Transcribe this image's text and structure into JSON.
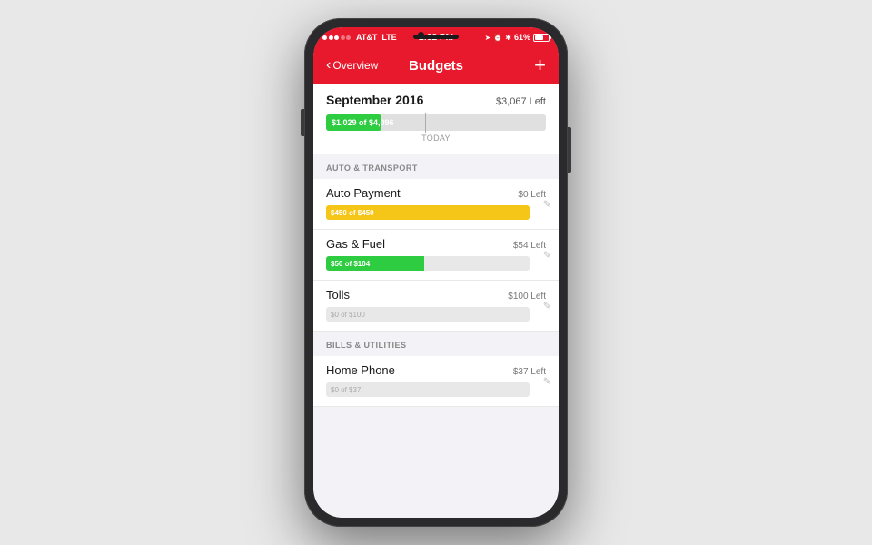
{
  "phone": {
    "status_bar": {
      "signal": "●●●○○",
      "carrier": "AT&T",
      "network": "LTE",
      "time": "2:32 PM",
      "battery_percent": "61%"
    },
    "nav": {
      "back_label": "Overview",
      "title": "Budgets",
      "add_label": "+"
    },
    "september": {
      "title": "September 2016",
      "amount_left": "$3,067 Left",
      "progress_label": "$1,029 of $4,096",
      "progress_percent": 25,
      "today_label": "TODAY"
    },
    "categories": [
      {
        "name": "AUTO & TRANSPORT",
        "items": [
          {
            "name": "Auto Payment",
            "left": "$0 Left",
            "progress_label": "$450 of $450",
            "progress_percent": 100,
            "color": "yellow"
          },
          {
            "name": "Gas & Fuel",
            "left": "$54 Left",
            "progress_label": "$50 of $104",
            "progress_percent": 48,
            "color": "green"
          },
          {
            "name": "Tolls",
            "left": "$100 Left",
            "progress_label": "$0 of $100",
            "progress_percent": 0,
            "color": "green"
          }
        ]
      },
      {
        "name": "BILLS & UTILITIES",
        "items": [
          {
            "name": "Home Phone",
            "left": "$37 Left",
            "progress_label": "$0 of $37",
            "progress_percent": 0,
            "color": "green"
          }
        ]
      }
    ]
  }
}
